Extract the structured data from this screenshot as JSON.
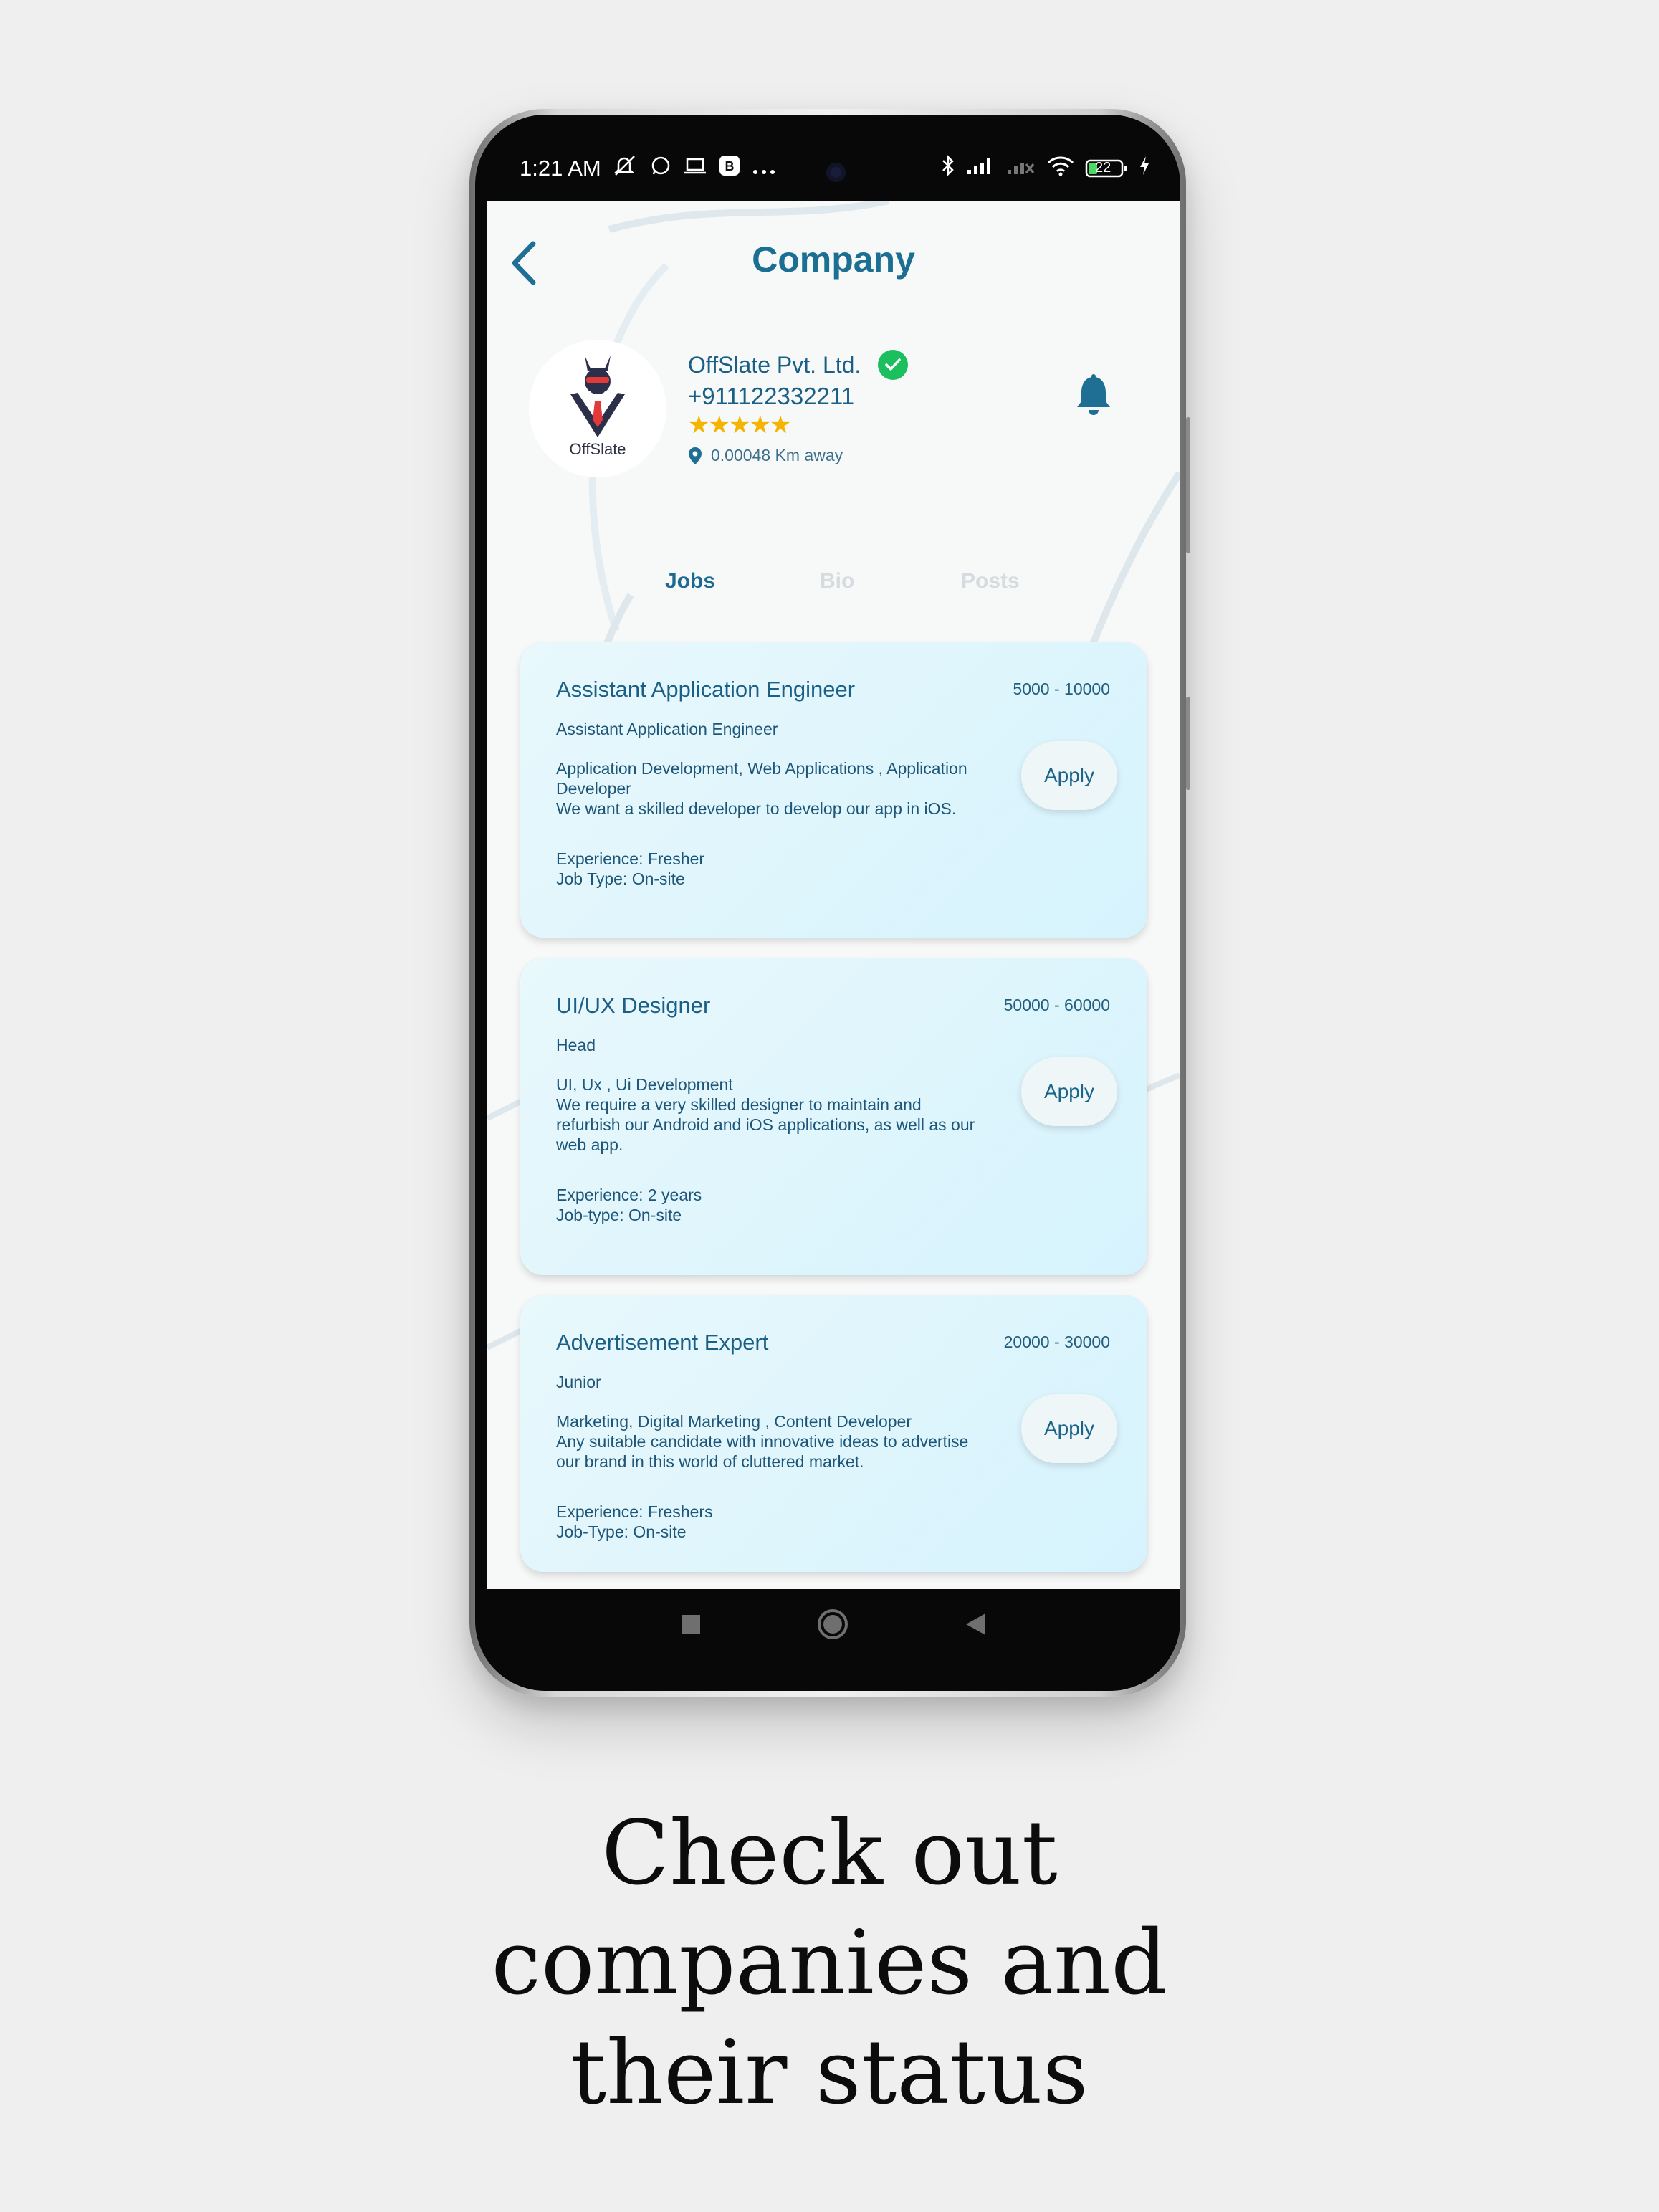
{
  "statusbar": {
    "time": "1:21 AM",
    "battery": "22"
  },
  "header": {
    "title": "Company"
  },
  "company": {
    "logo_text": "OffSlate",
    "name": "OffSlate Pvt. Ltd.",
    "phone": "+911122332211",
    "stars": "★★★★★",
    "rating": 5,
    "distance": "0.00048 Km away"
  },
  "tabs": [
    {
      "label": "Jobs",
      "active": true
    },
    {
      "label": "Bio",
      "active": false
    },
    {
      "label": "Posts",
      "active": false
    }
  ],
  "jobs": [
    {
      "title": "Assistant Application Engineer",
      "salary": "5000 - 10000",
      "role": "Assistant Application Engineer",
      "description": "Application Development, Web Applications , Application\nDeveloper\nWe want a skilled developer to develop our app in iOS.",
      "meta": "Experience: Fresher\nJob Type: On-site",
      "apply": "Apply"
    },
    {
      "title": "UI/UX Designer",
      "salary": "50000 - 60000",
      "role": "Head",
      "description": "UI, Ux , Ui Development\nWe require a very skilled designer to maintain and\nrefurbish our Android and iOS applications, as well as our\nweb app.",
      "meta": "Experience: 2 years\nJob-type: On-site",
      "apply": "Apply"
    },
    {
      "title": "Advertisement Expert",
      "salary": "20000 - 30000",
      "role": "Junior",
      "description": "Marketing, Digital Marketing , Content Developer\nAny suitable candidate with innovative ideas to advertise\nour brand in this world of cluttered market.",
      "meta": "Experience: Freshers\nJob-Type: On-site",
      "apply": "Apply"
    }
  ],
  "caption": "Check out\ncompanies and\ntheir status",
  "colors": {
    "accent": "#1b6f93",
    "verified": "#1cbf5e",
    "stars": "#f4b400",
    "card": "#dff5fd"
  }
}
